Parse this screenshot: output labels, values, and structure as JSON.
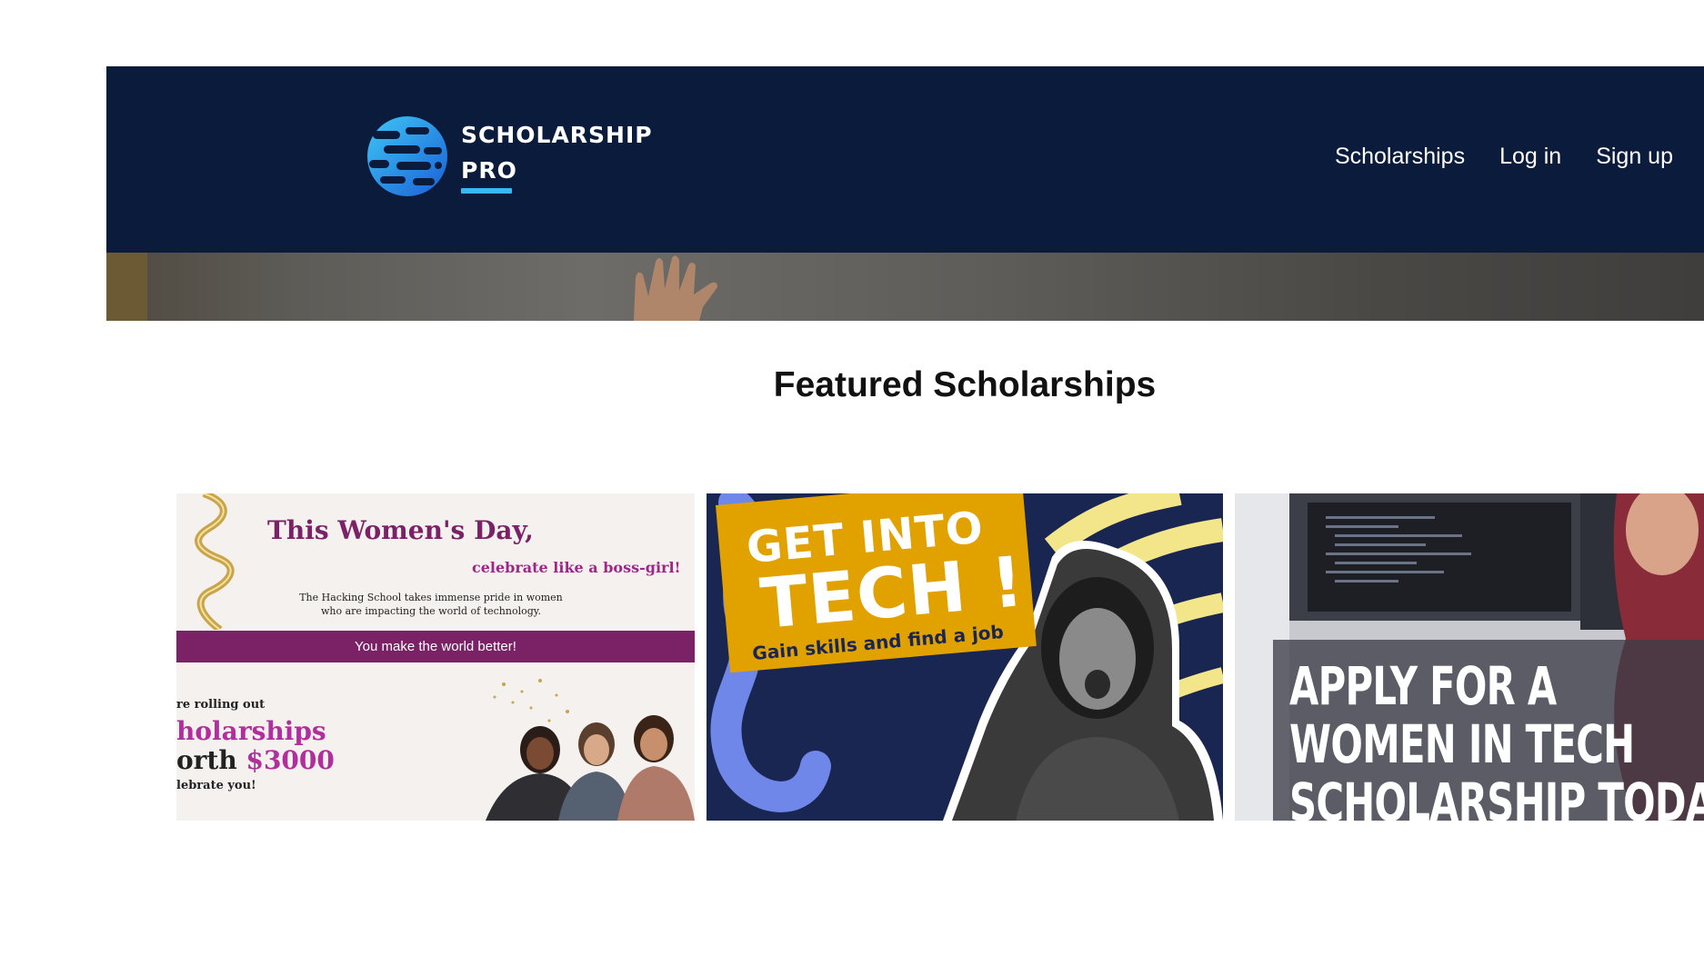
{
  "header": {
    "logo": {
      "line1": "SCHOLARSHIP",
      "line2": "PRO"
    },
    "nav": [
      {
        "label": "Scholarships"
      },
      {
        "label": "Log in"
      },
      {
        "label": "Sign up"
      }
    ]
  },
  "main": {
    "section_title": "Featured Scholarships",
    "cards": [
      {
        "title": "This Women's Day,",
        "subtitle": "celebrate like a boss-girl!",
        "body_line1": "The Hacking School takes immense pride in women",
        "body_line2": "who are impacting the world of technology.",
        "banner": "You make the world better!",
        "line_a": "re rolling out",
        "line_b": "holarships",
        "line_c": "orth",
        "amount": "$3000",
        "line_d": "lebrate you!"
      },
      {
        "line1": "GET INTO",
        "line2": "TECH !",
        "line3": "Gain skills and find a job"
      },
      {
        "line1": "APPLY FOR A",
        "line2": "WOMEN IN TECH",
        "line3": "SCHOLARSHIP TODA"
      }
    ]
  },
  "colors": {
    "header_bg": "#0b1b3c",
    "logo_accent": "#37b8f2",
    "card1_purple": "#7b2267",
    "card2_yellow": "#e1a200",
    "card2_navy": "#1a2652"
  }
}
